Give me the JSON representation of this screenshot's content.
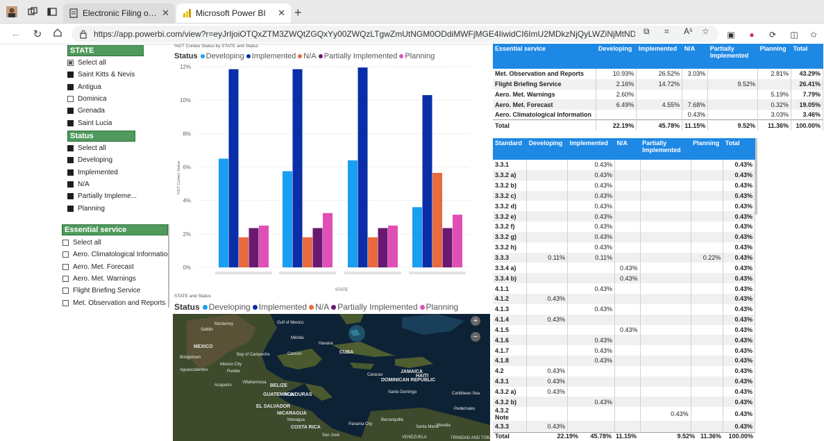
{
  "browser": {
    "tabs": [
      {
        "label": "Electronic Filing of Differences (E",
        "active": false
      },
      {
        "label": "Microsoft Power BI",
        "active": true
      }
    ],
    "url": "https://app.powerbi.com/view?r=eyJrIjoiOTQxZTM3ZWQtZGQxYy00ZWQzLTgwZmUtNGM0ODdiMWFjMGE4IiwidCI6ImU2MDkzNjQyLWZiNjMtNDhiYi04NjgzLWQxZDVkYTJhMTJlYSIsIm..."
  },
  "slicers": {
    "state": {
      "title": "STATE",
      "items": [
        {
          "label": "Select all",
          "state": "partial"
        },
        {
          "label": "Saint Kitts & Nevis",
          "state": "filled"
        },
        {
          "label": "Antigua",
          "state": "filled"
        },
        {
          "label": "Dominica",
          "state": "empty"
        },
        {
          "label": "Grenada",
          "state": "filled"
        },
        {
          "label": "Saint Lucia",
          "state": "filled"
        }
      ]
    },
    "status": {
      "title": "Status",
      "items": [
        {
          "label": "Select all",
          "state": "filled"
        },
        {
          "label": "Developing",
          "state": "filled"
        },
        {
          "label": "Implemented",
          "state": "filled"
        },
        {
          "label": "N/A",
          "state": "filled"
        },
        {
          "label": "Partially Impleme...",
          "state": "filled"
        },
        {
          "label": "Planning",
          "state": "filled"
        }
      ]
    },
    "essential": {
      "title": "Essential service",
      "items": [
        {
          "label": "Select all",
          "state": "empty"
        },
        {
          "label": "Aero. Climatological Information",
          "state": "empty"
        },
        {
          "label": "Aero. Met. Forecast",
          "state": "empty"
        },
        {
          "label": "Aero. Met. Warnings",
          "state": "empty"
        },
        {
          "label": "Flight Briefing Service",
          "state": "empty"
        },
        {
          "label": "Met. Observation and Reports",
          "state": "empty"
        }
      ]
    }
  },
  "chart": {
    "title": "%GT Conteo Status by STATE and Status",
    "ylabel": "%GT Conteo Status",
    "xlabel": "STATE",
    "legend_label": "Status",
    "legend": [
      "Developing",
      "Implemented",
      "N/A",
      "Partially Implemented",
      "Planning"
    ],
    "colors": [
      "#1a9ef2",
      "#0a2ea8",
      "#ea6a3f",
      "#6a1870",
      "#e04fb5"
    ],
    "yticks": [
      "12%",
      "10%",
      "8%",
      "6%",
      "4%",
      "2%",
      "0%"
    ]
  },
  "chart_data": {
    "type": "bar",
    "categories": [
      "",
      "",
      "",
      ""
    ],
    "series": [
      {
        "name": "Developing",
        "values": [
          6.5,
          5.75,
          6.4,
          3.6
        ]
      },
      {
        "name": "Implemented",
        "values": [
          11.85,
          11.85,
          11.95,
          10.3
        ]
      },
      {
        "name": "N/A",
        "values": [
          1.8,
          1.8,
          1.8,
          5.65
        ]
      },
      {
        "name": "Partially Implemented",
        "values": [
          2.35,
          2.35,
          2.35,
          2.35
        ]
      },
      {
        "name": "Planning",
        "values": [
          2.5,
          3.25,
          2.5,
          3.15
        ]
      }
    ],
    "title": "%GT Conteo Status by STATE and Status",
    "xlabel": "STATE",
    "ylabel": "%GT Conteo Status",
    "ylim": [
      0,
      12
    ],
    "grid": true,
    "legend_position": "top"
  },
  "map": {
    "title": "STATE and Status",
    "legend_label": "Status",
    "legend": [
      "Developing",
      "Implemented",
      "N/A",
      "Partially Implemented",
      "Planning"
    ],
    "zoom_in": "+",
    "zoom_out": "−",
    "labels": [
      "Monterrey",
      "Gulf of Mexico",
      "Saltillo",
      "MEXICO",
      "Mérida",
      "Havana",
      "CUBA",
      "Bay of Campeche",
      "Cancún",
      "Mexico City",
      "Puebla",
      "Villahermosa",
      "BELIZE",
      "Acapulco",
      "GUATEMALA",
      "HONDURAS",
      "EL SALVADOR",
      "NICARAGUA",
      "Managua",
      "COSTA RICA",
      "San José",
      "Panama City",
      "Barranquilla",
      "Santa Marta",
      "Caracas",
      "JAMAICA",
      "HAITI",
      "DOMINICAN REPUBLIC",
      "Santo Domingo",
      "Caribbean Sea",
      "Pedernales",
      "Bridgetown",
      "Aguascalientes",
      "Morelia",
      "TRINIDAD AND TOBAGO",
      "VENEZUELA"
    ]
  },
  "summary_table": {
    "headers": [
      "Essential service",
      "Developing",
      "Implemented",
      "N/A",
      "Partially Implemented",
      "Planning",
      "Total"
    ],
    "rows": [
      [
        "Met. Observation and Reports",
        "10.93%",
        "26.52%",
        "3.03%",
        "",
        "2.81%",
        "43.29%"
      ],
      [
        "Flight Briefing Service",
        "2.16%",
        "14.72%",
        "",
        "9.52%",
        "",
        "26.41%"
      ],
      [
        "Aero. Met. Warnings",
        "2.60%",
        "",
        "",
        "",
        "5.19%",
        "7.79%"
      ],
      [
        "Aero. Met. Forecast",
        "6.49%",
        "4.55%",
        "7.68%",
        "",
        "0.32%",
        "19.05%"
      ],
      [
        "Aero. Climatological Information",
        "",
        "",
        "0.43%",
        "",
        "3.03%",
        "3.46%"
      ]
    ],
    "total": [
      "Total",
      "22.19%",
      "45.78%",
      "11.15%",
      "9.52%",
      "11.36%",
      "100.00%"
    ]
  },
  "standard_table": {
    "headers": [
      "Standard",
      "Developing",
      "Implemented",
      "N/A",
      "Partially Implemented",
      "Planning",
      "Total"
    ],
    "rows": [
      [
        "3.3.1",
        "",
        "0.43%",
        "",
        "",
        "",
        "0.43%"
      ],
      [
        "3.3.2 a)",
        "",
        "0.43%",
        "",
        "",
        "",
        "0.43%"
      ],
      [
        "3.3.2 b)",
        "",
        "0.43%",
        "",
        "",
        "",
        "0.43%"
      ],
      [
        "3.3.2 c)",
        "",
        "0.43%",
        "",
        "",
        "",
        "0.43%"
      ],
      [
        "3.3.2 d)",
        "",
        "0.43%",
        "",
        "",
        "",
        "0.43%"
      ],
      [
        "3.3.2 e)",
        "",
        "0.43%",
        "",
        "",
        "",
        "0.43%"
      ],
      [
        "3.3.2 f)",
        "",
        "0.43%",
        "",
        "",
        "",
        "0.43%"
      ],
      [
        "3.3.2 g)",
        "",
        "0.43%",
        "",
        "",
        "",
        "0.43%"
      ],
      [
        "3.3.2 h)",
        "",
        "0.43%",
        "",
        "",
        "",
        "0.43%"
      ],
      [
        "3.3.3",
        "0.11%",
        "0.11%",
        "",
        "",
        "0.22%",
        "0.43%"
      ],
      [
        "3.3.4 a)",
        "",
        "",
        "0.43%",
        "",
        "",
        "0.43%"
      ],
      [
        "3.3.4 b)",
        "",
        "",
        "0.43%",
        "",
        "",
        "0.43%"
      ],
      [
        "4.1.1",
        "",
        "0.43%",
        "",
        "",
        "",
        "0.43%"
      ],
      [
        "4.1.2",
        "0.43%",
        "",
        "",
        "",
        "",
        "0.43%"
      ],
      [
        "4.1.3",
        "",
        "0.43%",
        "",
        "",
        "",
        "0.43%"
      ],
      [
        "4.1.4",
        "0.43%",
        "",
        "",
        "",
        "",
        "0.43%"
      ],
      [
        "4.1.5",
        "",
        "",
        "0.43%",
        "",
        "",
        "0.43%"
      ],
      [
        "4.1.6",
        "",
        "0.43%",
        "",
        "",
        "",
        "0.43%"
      ],
      [
        "4.1.7",
        "",
        "0.43%",
        "",
        "",
        "",
        "0.43%"
      ],
      [
        "4.1.8",
        "",
        "0.43%",
        "",
        "",
        "",
        "0.43%"
      ],
      [
        "4.2",
        "0.43%",
        "",
        "",
        "",
        "",
        "0.43%"
      ],
      [
        "4.3.1",
        "0.43%",
        "",
        "",
        "",
        "",
        "0.43%"
      ],
      [
        "4.3.2 a)",
        "0.43%",
        "",
        "",
        "",
        "",
        "0.43%"
      ],
      [
        "4.3.2 b)",
        "",
        "0.43%",
        "",
        "",
        "",
        "0.43%"
      ],
      [
        "4.3.2 Note",
        "",
        "",
        "",
        "0.43%",
        "",
        "0.43%"
      ],
      [
        "4.3.3",
        "0.43%",
        "",
        "",
        "",
        "",
        "0.43%"
      ]
    ],
    "total": [
      "Total",
      "22.19%",
      "45.78%",
      "11.15%",
      "",
      "9.52%",
      "11.36%",
      "100.00%"
    ]
  }
}
